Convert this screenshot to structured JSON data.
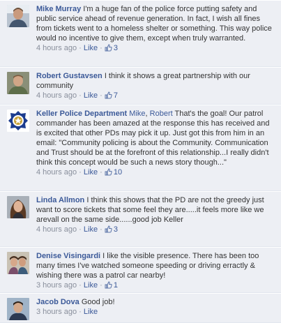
{
  "colors": {
    "background": "#edeff4",
    "link": "#3b5998",
    "meta": "#898f9c",
    "text": "#333333"
  },
  "comments": [
    {
      "author": "Mike Murray",
      "mentions": [],
      "text": "I'm a huge fan of the police force putting safety and public service ahead of revenue generation. In fact, I wish all fines from tickets went to a homeless shelter or something. This way police would no incentive to give them, except when truly warranted.",
      "time": "4 hours ago",
      "like_label": "Like",
      "likes": "3",
      "avatar_icon": "user-photo"
    },
    {
      "author": "Robert Gustavsen",
      "mentions": [],
      "text": "I think it shows a great partnership with our community",
      "time": "4 hours ago",
      "like_label": "Like",
      "likes": "7",
      "avatar_icon": "user-photo"
    },
    {
      "author": "Keller Police Department",
      "mentions": [
        "Mike",
        "Robert"
      ],
      "text": "That's the goal! Our patrol commander has been amazed at the response this has received and is excited that other PDs may pick it up. Just got this from him in an email: \"Community policing is about the Community. Communication and Trust should be at the forefront of this relationship...I really didn't think this concept would be such a news story though...\"",
      "time": "4 hours ago",
      "like_label": "Like",
      "likes": "10",
      "avatar_icon": "police-badge"
    },
    {
      "author": "Linda Allmon",
      "mentions": [],
      "text": "I think this shows that the PD are not the greedy just want to score tickets that some feel they are.....it feels more like we arevall on the same side......good job Keller",
      "time": "4 hours ago",
      "like_label": "Like",
      "likes": "3",
      "avatar_icon": "user-photo"
    },
    {
      "author": "Denise Visingardi",
      "mentions": [],
      "text": "I like the visible presence. There has been too many times I've watched someone speeding or driving erractly & wishing there was a patrol car nearby!",
      "time": "3 hours ago",
      "like_label": "Like",
      "likes": "1",
      "avatar_icon": "user-photo"
    },
    {
      "author": "Jacob Dova",
      "mentions": [],
      "text": "Good job!",
      "time": "3 hours ago",
      "like_label": "Like",
      "likes": "",
      "avatar_icon": "user-photo"
    }
  ]
}
